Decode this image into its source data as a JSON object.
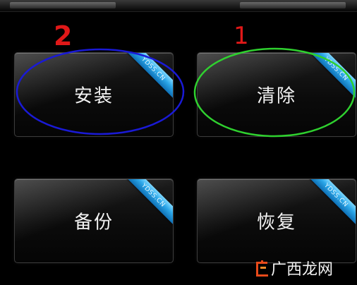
{
  "tiles": {
    "install": {
      "label": "安装",
      "ribbon": "YDSS.CN"
    },
    "clear": {
      "label": "清除",
      "ribbon": "YDSS.CN"
    },
    "backup": {
      "label": "备份",
      "ribbon": "YDSS.CN"
    },
    "restore": {
      "label": "恢复",
      "ribbon": "YDSS.CN"
    }
  },
  "annotations": {
    "marker_left": "2",
    "marker_right": "1",
    "colors": {
      "left_circle": "#1a1ad6",
      "right_circle": "#2fd12f",
      "marker": "#e01818"
    }
  },
  "watermark": {
    "text": "广西龙网"
  }
}
